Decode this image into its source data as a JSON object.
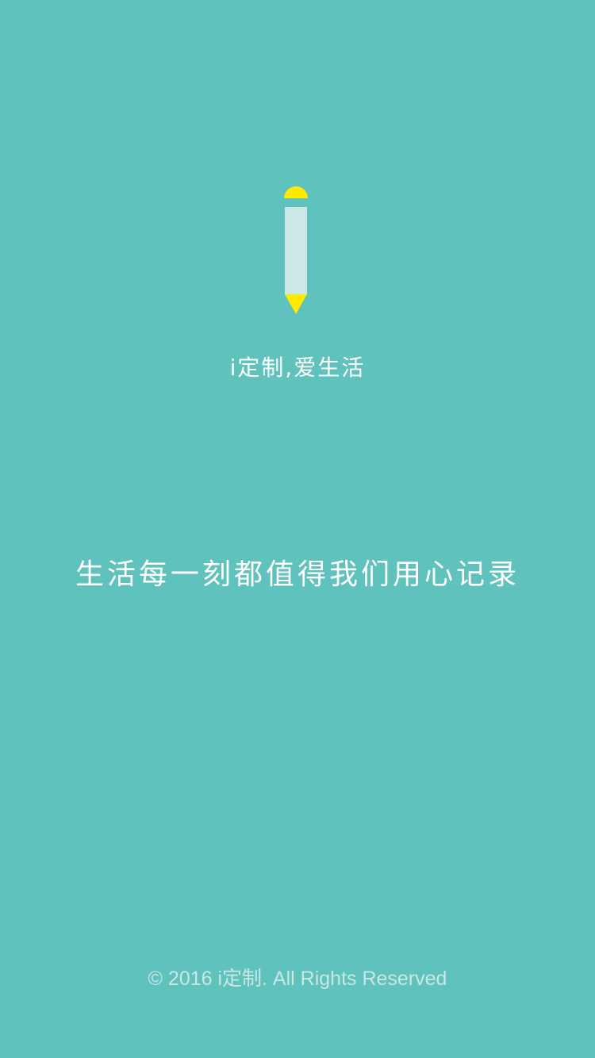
{
  "colors": {
    "background": "#60c2bc",
    "accent_yellow": "#ffea00",
    "pencil_body": "#cce7e8",
    "text_primary": "#ffffff",
    "text_muted": "#c9e7e4"
  },
  "logo": {
    "icon": "pencil-icon"
  },
  "slogan": "i定制,爱生活",
  "tagline": "生活每一刻都值得我们用心记录",
  "footer": "© 2016 i定制.  All Rights Reserved"
}
